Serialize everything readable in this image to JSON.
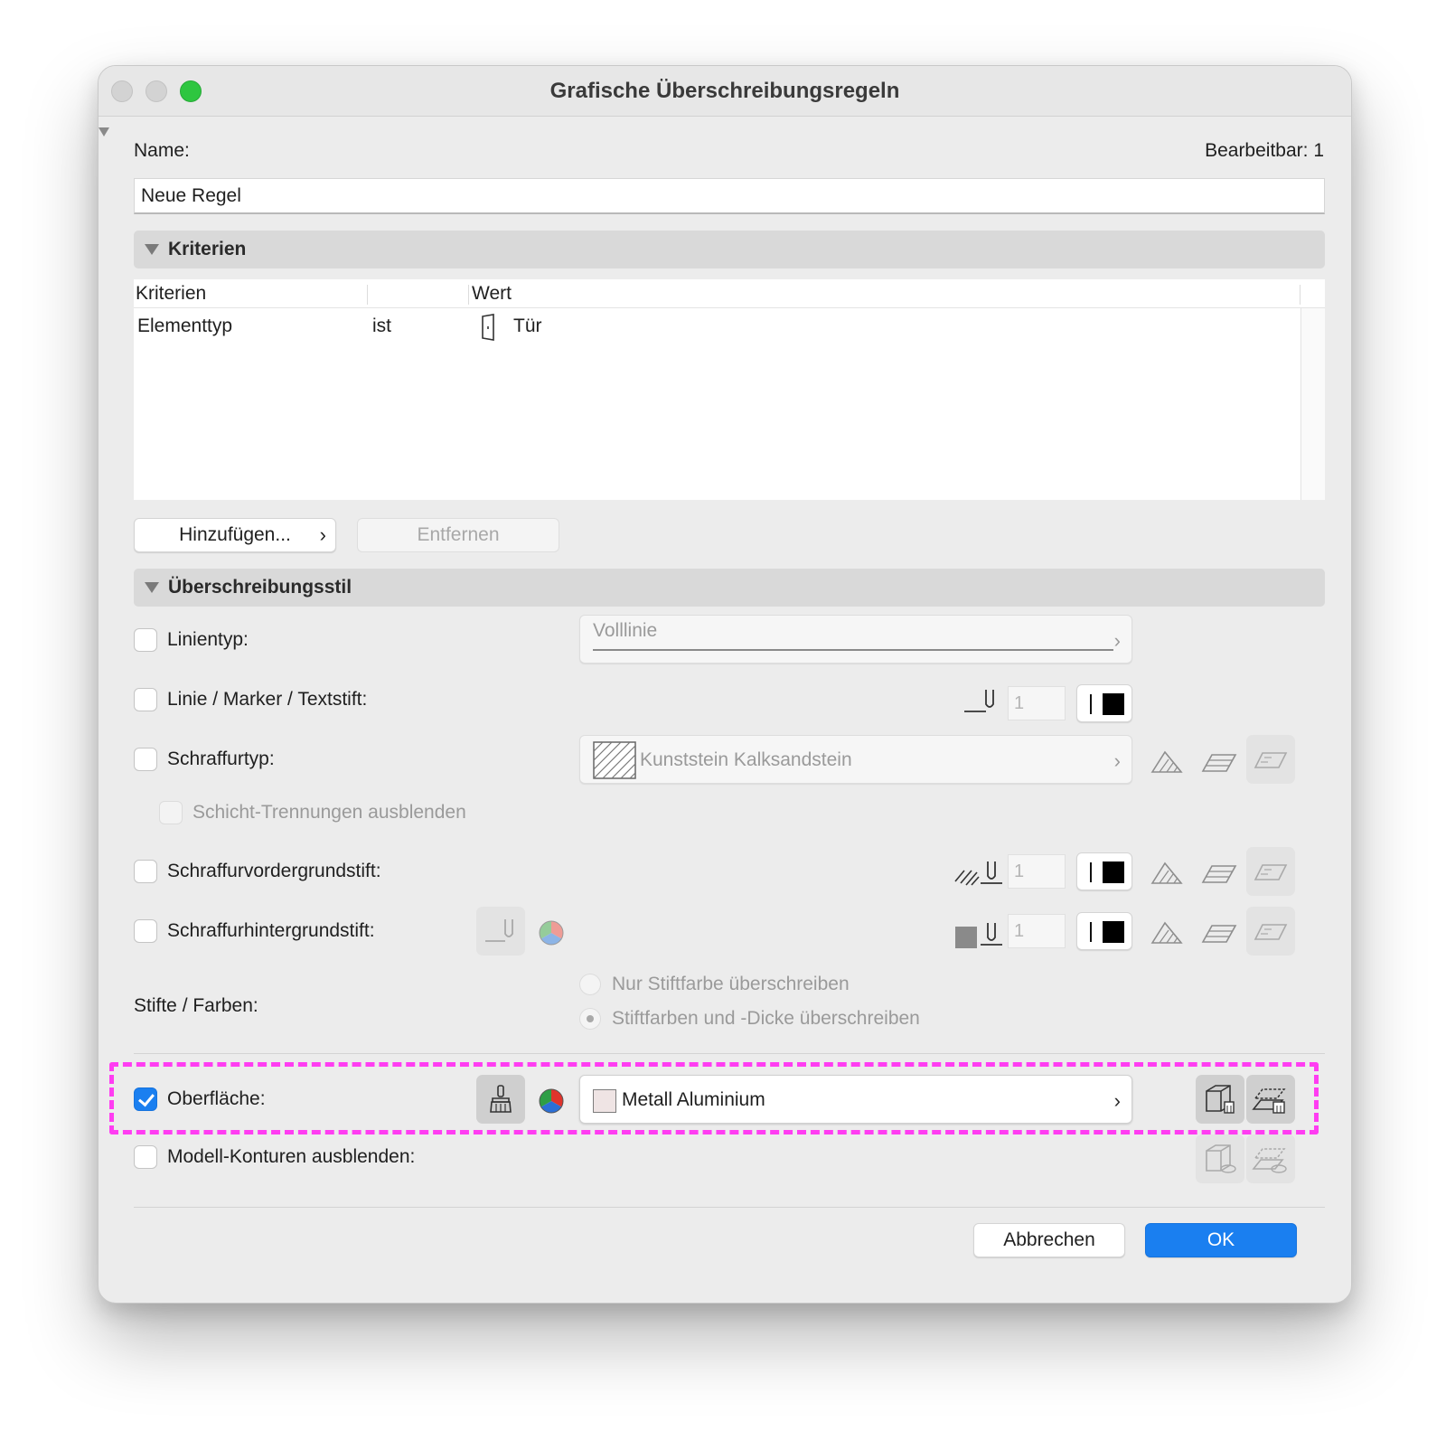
{
  "window": {
    "title": "Grafische Überschreibungsregeln"
  },
  "name": {
    "label": "Name:",
    "editable_label": "Bearbeitbar: 1",
    "value": "Neue Regel"
  },
  "criteria": {
    "section_title": "Kriterien",
    "columns": [
      "Kriterien",
      "Wert"
    ],
    "rows": [
      {
        "criterion": "Elementtyp",
        "operator": "ist",
        "value": "Tür",
        "icon": "door-icon"
      }
    ],
    "add_button": "Hinzufügen...",
    "remove_button": "Entfernen"
  },
  "style": {
    "section_title": "Überschreibungsstil",
    "linetype": {
      "label": "Linientyp:",
      "checked": false,
      "value": "Volllinie"
    },
    "line_pen": {
      "label": "Linie / Marker / Textstift:",
      "checked": false,
      "pen_number": "1"
    },
    "hatch_type": {
      "label": "Schraffurtyp:",
      "checked": false,
      "value": "Kunststein Kalksandstein",
      "sub_option": "Schicht-Trennungen ausblenden"
    },
    "hatch_fg_pen": {
      "label": "Schraffurvordergrundstift:",
      "checked": false,
      "pen_number": "1"
    },
    "hatch_bg_pen": {
      "label": "Schraffurhintergrundstift:",
      "checked": false,
      "pen_number": "1"
    },
    "pens_colors": {
      "label": "Stifte / Farben:",
      "options": [
        "Nur Stiftfarbe überschreiben",
        "Stiftfarben und -Dicke überschreiben"
      ],
      "selected_index": 1
    },
    "surface": {
      "label": "Oberfläche:",
      "checked": true,
      "value": "Metall Aluminium"
    },
    "model_contours": {
      "label": "Modell-Konturen ausblenden:",
      "checked": false
    }
  },
  "footer": {
    "cancel": "Abbrechen",
    "ok": "OK"
  },
  "colors": {
    "accent": "#1a7ff0",
    "highlight": "#ff3df2",
    "traffic_green": "#2ec640"
  }
}
